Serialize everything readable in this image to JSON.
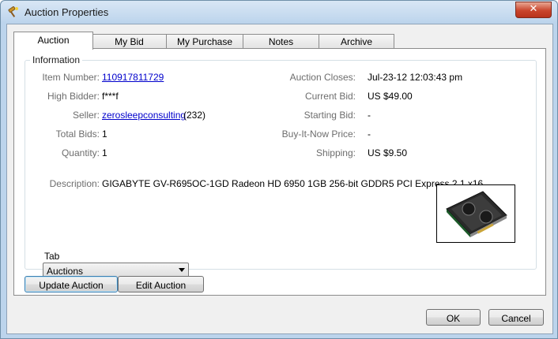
{
  "window": {
    "title": "Auction Properties",
    "close_glyph": "✕"
  },
  "tabs": [
    {
      "label": "Auction",
      "active": true
    },
    {
      "label": "My Bid",
      "active": false
    },
    {
      "label": "My Purchase",
      "active": false
    },
    {
      "label": "Notes",
      "active": false
    },
    {
      "label": "Archive",
      "active": false
    }
  ],
  "info": {
    "legend": "Information",
    "item_number_label": "Item Number:",
    "item_number": "110917811729",
    "high_bidder_label": "High Bidder:",
    "high_bidder": "f***f",
    "seller_label": "Seller:",
    "seller": "zerosleepconsulting",
    "seller_feedback": "(232)",
    "total_bids_label": "Total Bids:",
    "total_bids": "1",
    "quantity_label": "Quantity:",
    "quantity": "1",
    "auction_closes_label": "Auction Closes:",
    "auction_closes": "Jul-23-12 12:03:43 pm",
    "current_bid_label": "Current Bid:",
    "current_bid": "US $49.00",
    "starting_bid_label": "Starting Bid:",
    "starting_bid": "-",
    "buy_it_now_label": "Buy-It-Now Price:",
    "buy_it_now": "-",
    "shipping_label": "Shipping:",
    "shipping": "US $9.50",
    "description_label": "Description:",
    "description": "GIGABYTE GV-R695OC-1GD Radeon HD 6950 1GB 256-bit GDDR5 PCI Express 2.1 x16"
  },
  "tab_select": {
    "label": "Tab",
    "value": "Auctions"
  },
  "buttons": {
    "update_auction": "Update Auction",
    "edit_auction": "Edit Auction",
    "ok": "OK",
    "cancel": "Cancel"
  },
  "colors": {
    "link": "#0000cc",
    "title_bg": "#bcd4ec",
    "close_btn": "#c9452c"
  },
  "icons": {
    "app": "gavel-icon",
    "thumbnail": "graphics-card-thumbnail"
  }
}
